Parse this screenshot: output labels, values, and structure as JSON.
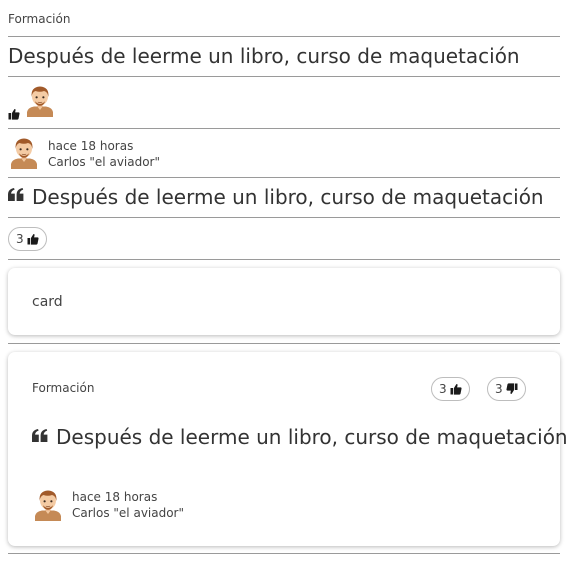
{
  "top": {
    "category": "Formación",
    "title": "Después de leerme un libro, curso de maquetación"
  },
  "post": {
    "time": "hace 18 horas",
    "author": "Carlos \"el aviador\"",
    "quote": "Después de leerme un libro, curso de maquetación",
    "likes": "3"
  },
  "card1": {
    "text": "card"
  },
  "card2": {
    "category": "Formación",
    "likes": "3",
    "dislikes": "3",
    "quote": "Después de leerme un libro, curso de maquetación",
    "time": "hace 18 horas",
    "author": "Carlos \"el aviador\""
  },
  "icons": {
    "like": "thumbs-up-icon",
    "dislike": "thumbs-down-icon",
    "quote": "quote-left-icon",
    "avatar": "avatar-man"
  }
}
